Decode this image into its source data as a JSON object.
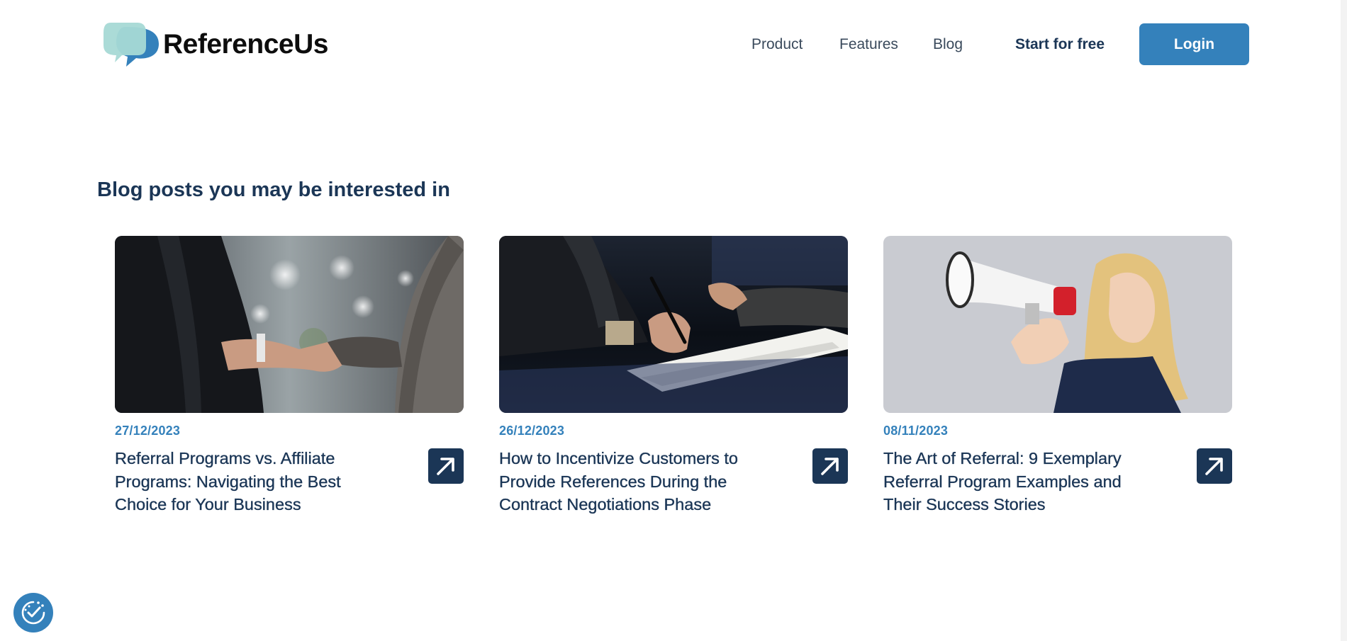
{
  "brand": {
    "name": "ReferenceUs",
    "colors": {
      "primary": "#3481bb",
      "navy": "#1b3656",
      "bubble_light": "#a7d9d5",
      "bubble_dark": "#3481bb"
    }
  },
  "nav": {
    "product": "Product",
    "features": "Features",
    "blog": "Blog",
    "start": "Start for free",
    "login": "Login"
  },
  "section": {
    "title": "Blog posts you may be interested in"
  },
  "posts": [
    {
      "date": "27/12/2023",
      "title": "Referral Programs vs. Affiliate Programs: Navigating the Best Choice for Your Business",
      "image": "handshake-photo",
      "arrow_icon": "arrow-up-right-icon"
    },
    {
      "date": "26/12/2023",
      "title": "How to Incentivize Customers to Provide References During the Contract Negotiations Phase",
      "image": "contract-signing-photo",
      "arrow_icon": "arrow-up-right-icon"
    },
    {
      "date": "08/11/2023",
      "title": "The Art of Referral: 9 Exemplary Referral Program Examples and Their Success Stories",
      "image": "megaphone-woman-photo",
      "arrow_icon": "arrow-up-right-icon"
    }
  ],
  "consent": {
    "icon": "cookie-consent-icon"
  }
}
